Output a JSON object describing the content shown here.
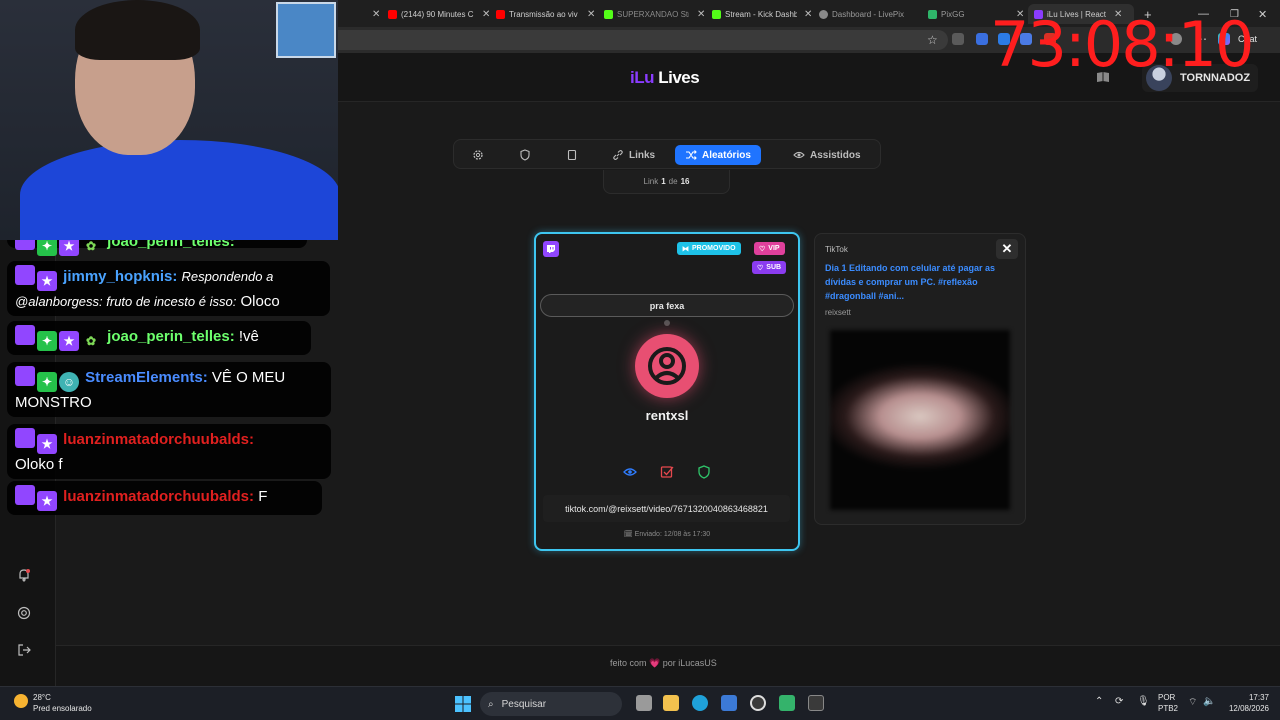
{
  "timer": "73:08:10",
  "browser": {
    "tabs": [
      {
        "label": "(2144) 90 Minutes C",
        "color": "#ff0000"
      },
      {
        "label": "Transmissão ao viv",
        "color": "#ff0000"
      },
      {
        "label": "SUPERXANDAO Str",
        "color": "#53fc18"
      },
      {
        "label": "Stream - Kick Dashb",
        "color": "#53fc18"
      },
      {
        "label": "Dashboard - LivePix",
        "color": "#8a8a8a"
      },
      {
        "label": "PixGG",
        "color": "#2fb56a"
      },
      {
        "label": "iLu Lives | React",
        "color": "#8a3cff"
      }
    ],
    "chat_label": "Chat"
  },
  "app": {
    "logo_ilu": "iLu",
    "logo_lives": "Lives",
    "username": "TORNNADOZ",
    "nav": {
      "links_label": "Links",
      "random_label": "Aleatórios",
      "watched_label": "Assistidos"
    },
    "link_counter": {
      "prefix": "Link",
      "current": "1",
      "sep": "de",
      "total": "16"
    },
    "card": {
      "promo_label": "PROMOVIDO",
      "vip_label": "VIP",
      "sub_label": "SUB",
      "message": "pra fexa",
      "user": "rentxsl",
      "url": "tiktok.com/@reixsett/video/7671320040863468821",
      "sent": "Enviado: 12/08 às 17:30"
    },
    "tiktok": {
      "label": "TikTok",
      "title": "Dia 1 Editando com celular até pagar as dívidas e comprar um PC. #reflexão #dragonball #ani...",
      "author": "reixsett"
    },
    "footer": {
      "prefix": "feito com",
      "heart": "💗",
      "suffix": "por iLucasUS"
    }
  },
  "chat": [
    {
      "user": "joao_perin_telles:",
      "text": "",
      "color": "#6dff6d"
    },
    {
      "user": "jimmy_hopknis:",
      "text_italic": "Respondendo a @alanborgess: fruto de incesto é isso:",
      "text": "Oloco",
      "color": "#4aa3ff"
    },
    {
      "user": "joao_perin_telles:",
      "text": "!vê",
      "color": "#6dff6d"
    },
    {
      "user": "StreamElements:",
      "text": "VÊ O MEU MONSTRO",
      "color": "#4a8cff"
    },
    {
      "user": "luanzinmatadorchuubalds:",
      "text": "Oloko f",
      "color": "#e0201f"
    },
    {
      "user": "luanzinmatadorchuubalds:",
      "text": "F",
      "color": "#e0201f"
    }
  ],
  "taskbar": {
    "temp": "28°C",
    "weather": "Pred ensolarado",
    "search": "Pesquisar",
    "lang1": "POR",
    "lang2": "PTB2",
    "time": "17:37",
    "date": "12/08/2026"
  }
}
